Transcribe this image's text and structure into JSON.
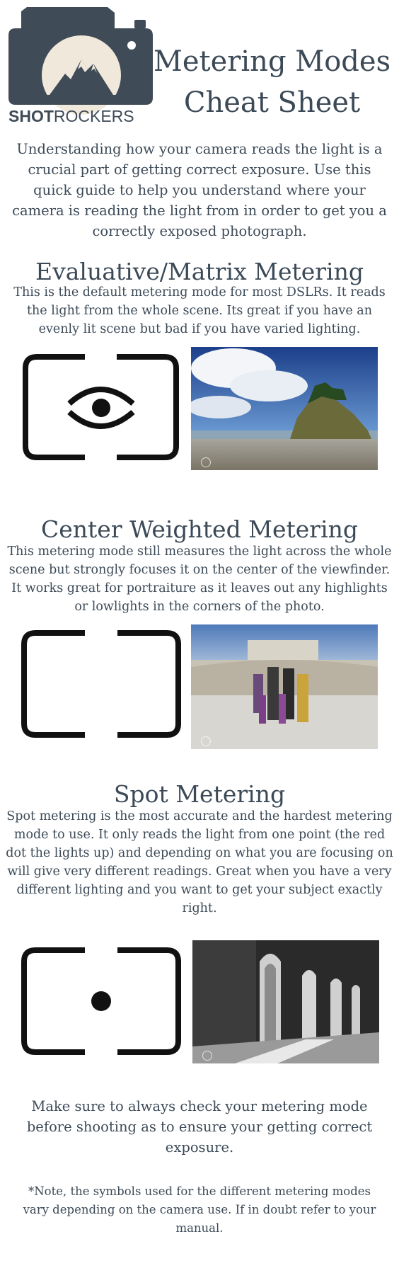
{
  "header": {
    "brand_bold": "SHOT",
    "brand_light": "ROCKERS",
    "title_line1": "Metering Modes",
    "title_line2": "Cheat Sheet"
  },
  "intro": "Understanding how your camera reads the light is a crucial part of getting correct exposure.  Use this quick guide to help you understand where your camera is reading the light from in order to get you a correctly exposed photograph.",
  "sections": [
    {
      "title": "Evaluative/Matrix Metering",
      "description": "This is the default metering mode for most DSLRs.  It reads the light from the whole scene.  Its great if you have an evenly lit scene but bad if you have varied lighting.",
      "icon": "evaluative-metering-icon"
    },
    {
      "title": "Center Weighted Metering",
      "description": "This metering mode still measures the light across the whole scene but strongly focuses it on the center of the viewfinder.  It works great for portraiture as it leaves out any highlights or lowlights in the corners of the photo.",
      "icon": "center-weighted-metering-icon"
    },
    {
      "title": "Spot Metering",
      "description": "Spot metering is the most accurate and the hardest metering mode to use.  It only reads the light from one point (the red dot the lights up) and depending on what you are focusing on will give very different readings.  Great when you have a very different lighting and you want to get your subject exactly right.",
      "icon": "spot-metering-icon"
    }
  ],
  "closing": "Make sure to always check your metering mode before shooting as to ensure your getting correct exposure.",
  "note": "*Note, the symbols used for the different metering modes vary depending on the camera use.  If in doubt refer to your manual.",
  "colors": {
    "text": "#3c4a57",
    "logo_body": "#3f4b57",
    "logo_sun": "#f1e8dc",
    "icon": "#111111"
  }
}
